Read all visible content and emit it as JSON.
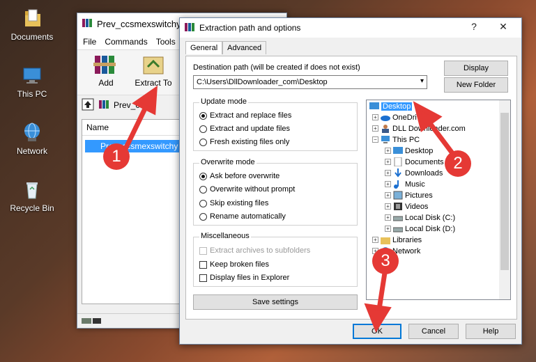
{
  "desktop": {
    "icons": [
      {
        "label": "Documents",
        "icon": "folder-documents-icon"
      },
      {
        "label": "This PC",
        "icon": "computer-icon"
      },
      {
        "label": "Network",
        "icon": "network-icon"
      },
      {
        "label": "Recycle Bin",
        "icon": "recycle-bin-icon"
      }
    ]
  },
  "winrar": {
    "title": "Prev_ccsmexswitchy",
    "menu": [
      "File",
      "Commands",
      "Tools"
    ],
    "toolbar": {
      "add": "Add",
      "extract_to": "Extract To"
    },
    "path_text": "Prev_ccsm",
    "list_header": "Name",
    "file_name": "Prev_ccsmexswitchy"
  },
  "dialog": {
    "title": "Extraction path and options",
    "help_glyph": "?",
    "close_glyph": "✕",
    "tabs": [
      "General",
      "Advanced"
    ],
    "dest_label": "Destination path (will be created if does not exist)",
    "dest_value": "C:\\Users\\DllDownloader_com\\Desktop",
    "display_btn": "Display",
    "new_folder_btn": "New Folder",
    "update_mode": {
      "title": "Update mode",
      "options": [
        "Extract and replace files",
        "Extract and update files",
        "Fresh existing files only"
      ],
      "selected": 0
    },
    "overwrite_mode": {
      "title": "Overwrite mode",
      "options": [
        "Ask before overwrite",
        "Overwrite without prompt",
        "Skip existing files",
        "Rename automatically"
      ],
      "selected": 0
    },
    "misc": {
      "title": "Miscellaneous",
      "options": [
        "Extract archives to subfolders",
        "Keep broken files",
        "Display files in Explorer"
      ]
    },
    "save_settings": "Save settings",
    "tree": [
      {
        "label": "Desktop",
        "selected": true
      },
      {
        "label": "OneDrive"
      },
      {
        "label": "DLL Downloader.com"
      },
      {
        "label": "This PC"
      },
      {
        "label": "Desktop"
      },
      {
        "label": "Documents"
      },
      {
        "label": "Downloads"
      },
      {
        "label": "Music"
      },
      {
        "label": "Pictures"
      },
      {
        "label": "Videos"
      },
      {
        "label": "Local Disk (C:)"
      },
      {
        "label": "Local Disk (D:)"
      },
      {
        "label": "Libraries"
      },
      {
        "label": "Network"
      }
    ],
    "ok": "OK",
    "cancel": "Cancel",
    "help": "Help"
  },
  "annotations": {
    "step1": "1",
    "step2": "2",
    "step3": "3",
    "color": "#e53935"
  }
}
